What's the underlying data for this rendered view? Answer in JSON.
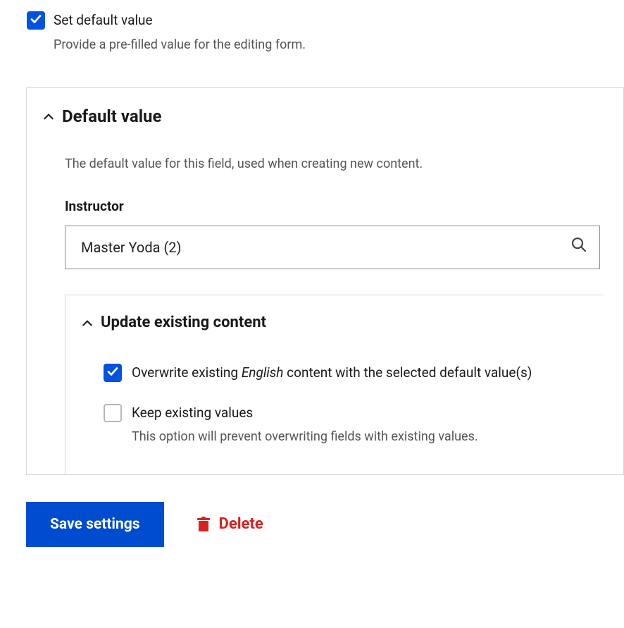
{
  "setDefault": {
    "label": "Set default value",
    "description": "Provide a pre-filled value for the editing form.",
    "checked": true
  },
  "defaultValuePanel": {
    "title": "Default value",
    "description": "The default value for this field, used when creating new content.",
    "field": {
      "label": "Instructor",
      "value": "Master Yoda (2)"
    }
  },
  "updateExisting": {
    "title": "Update existing content",
    "overwrite": {
      "checked": true,
      "prefix": "Overwrite existing ",
      "em": "English",
      "suffix": " content with the selected default value(s)"
    },
    "keepExisting": {
      "checked": false,
      "label": "Keep existing values",
      "description": "This option will prevent overwriting fields with existing values."
    }
  },
  "actions": {
    "save": "Save settings",
    "delete": "Delete"
  }
}
